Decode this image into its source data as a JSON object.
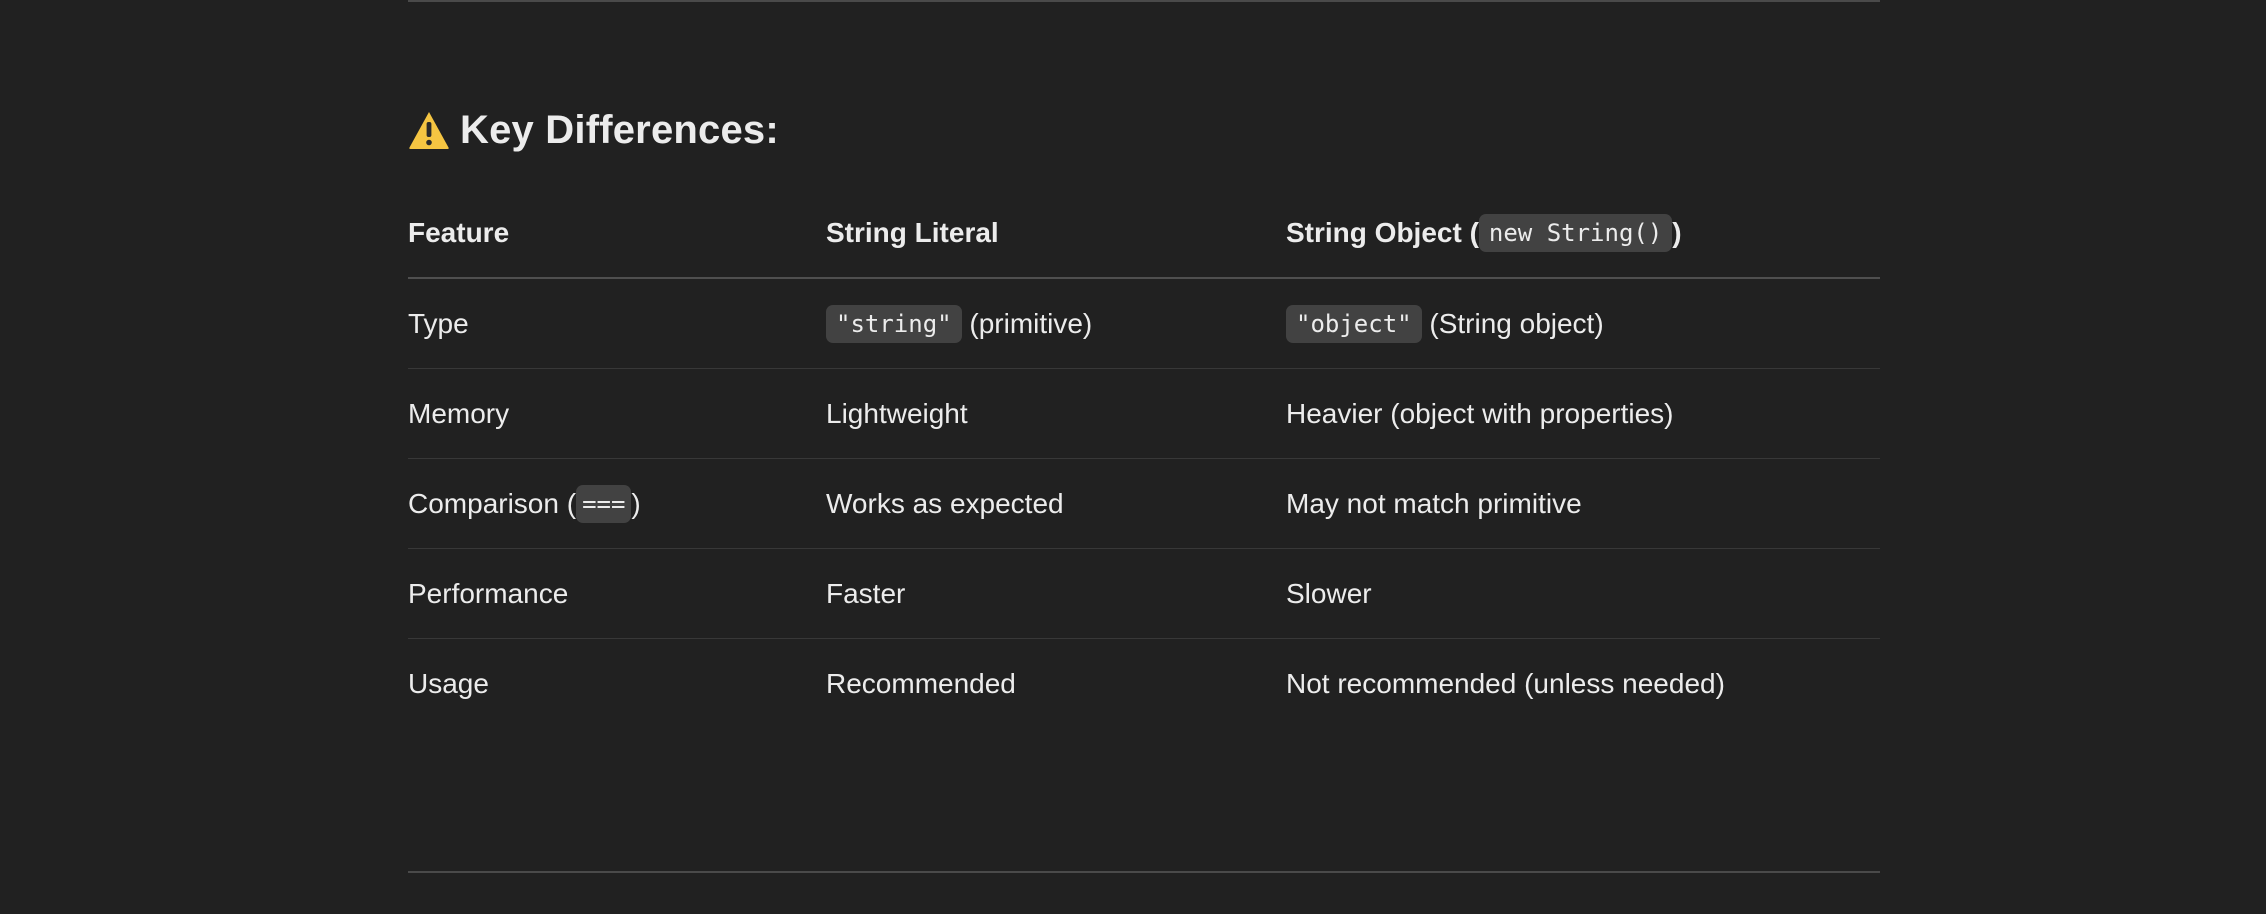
{
  "heading": {
    "icon": "warning-icon",
    "text": "Key Differences:"
  },
  "table": {
    "headers": {
      "feature": "Feature",
      "literal": "String Literal",
      "object_prefix": "String Object (",
      "object_code": "new String()",
      "object_suffix": ")"
    },
    "rows": [
      {
        "feature": "Type",
        "literal_code": "\"string\"",
        "literal_text": " (primitive)",
        "object_code": "\"object\"",
        "object_text": " (String object)"
      },
      {
        "feature": "Memory",
        "literal": "Lightweight",
        "object": "Heavier (object with properties)"
      },
      {
        "feature_prefix": "Comparison (",
        "feature_code": "===",
        "feature_suffix": ")",
        "literal": "Works as expected",
        "object": "May not match primitive"
      },
      {
        "feature": "Performance",
        "literal": "Faster",
        "object": "Slower"
      },
      {
        "feature": "Usage",
        "literal": "Recommended",
        "object": "Not recommended (unless needed)"
      }
    ]
  },
  "colors": {
    "background": "#212121",
    "text": "#ececec",
    "code_background": "#424242",
    "warning": "#f5c542"
  }
}
